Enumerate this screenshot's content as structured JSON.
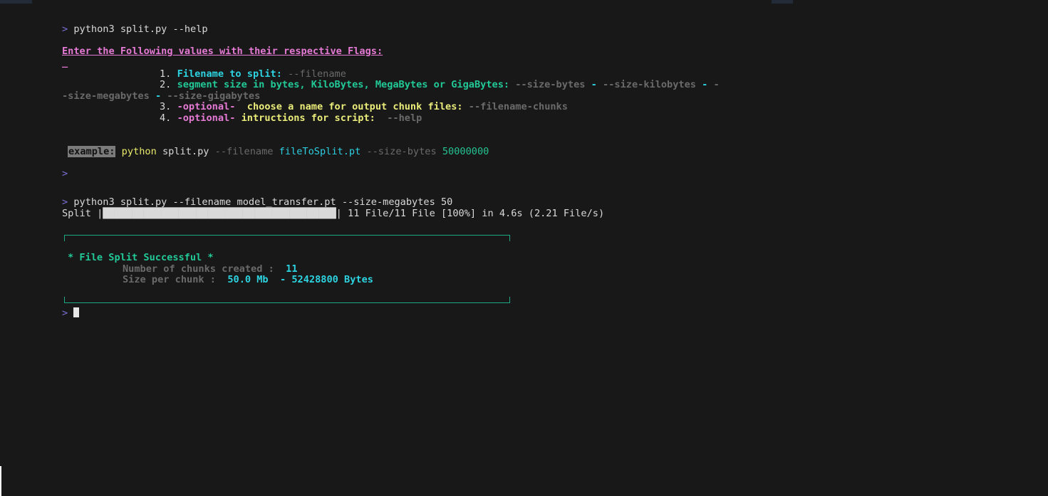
{
  "terminal": {
    "prompt_symbol": ">",
    "cmd1": "python3 split.py --help",
    "help": {
      "title": "Enter the Following values with their respective Flags:",
      "underscore": "_",
      "item1_num": "1.",
      "item1_text": "Filename to split:",
      "item1_flag": "--filename",
      "item2_num": "2.",
      "item2_text": "segment size in bytes, KiloBytes, MegaBytes or GigaBytes:",
      "item2_flag_bytes": "--size-bytes",
      "dash": "-",
      "item2_flag_kb": "--size-kilobytes",
      "item2_flag_mb_tail": "-size-megabytes",
      "item2_flag_gb": "--size-gigabytes",
      "item3_num": "3.",
      "item3_optional": "-optional-",
      "item3_text": "choose a name for output chunk files:",
      "item3_flag": "--filename-chunks",
      "item4_num": "4.",
      "item4_optional": "-optional-",
      "item4_text": "intructions for script:",
      "item4_flag": "--help"
    },
    "example": {
      "label": "example:",
      "python": "python",
      "script": "split.py",
      "flag_filename": "--filename",
      "file_value": "fileToSplit.pt",
      "flag_size": "--size-bytes",
      "size_value": "50000000"
    },
    "cmd2": "python3 split.py --filename model_transfer.pt --size-megabytes 50",
    "progress": {
      "label": "Split",
      "value": 1.0,
      "stats": "11 File/11 File [100%] in 4.6s (2.21 File/s)"
    },
    "result": {
      "title": "* File Split Successful *",
      "chunks_label": "Number of chunks created :",
      "chunks_value": "11",
      "size_label": "Size per chunk :",
      "size_value": "50.0 Mb  - 52428800 Bytes"
    }
  },
  "colors": {
    "background": "#181818",
    "pink": "#e57ad4",
    "cyan": "#2dd3e0",
    "green": "#22c997",
    "yellow": "#eaec7a",
    "prompt": "#7a6fd6"
  }
}
